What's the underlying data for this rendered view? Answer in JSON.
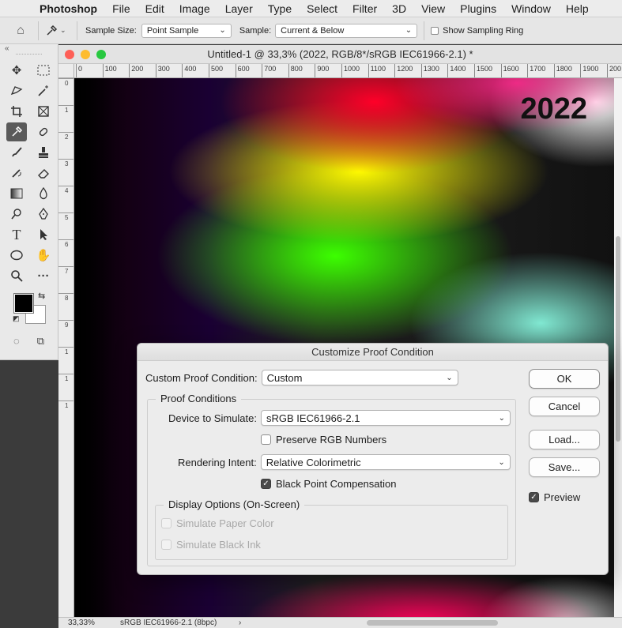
{
  "menubar": {
    "app": "Photoshop",
    "items": [
      "File",
      "Edit",
      "Image",
      "Layer",
      "Type",
      "Select",
      "Filter",
      "3D",
      "View",
      "Plugins",
      "Window",
      "Help"
    ]
  },
  "options_bar": {
    "sample_size_label": "Sample Size:",
    "sample_size_value": "Point Sample",
    "sample_label": "Sample:",
    "sample_value": "Current & Below",
    "show_ring_label": "Show Sampling Ring"
  },
  "document": {
    "title": "Untitled-1 @ 33,3% (2022, RGB/8*/sRGB IEC61966-2.1) *",
    "ruler_ticks": [
      "0",
      "100",
      "200",
      "300",
      "400",
      "500",
      "600",
      "700",
      "800",
      "900",
      "1000",
      "1100",
      "1200",
      "1300",
      "1400",
      "1500",
      "1600",
      "1700",
      "1800",
      "1900",
      "200"
    ],
    "vruler_labels": [
      "0",
      "1",
      "2",
      "3",
      "4",
      "5",
      "6",
      "7",
      "8",
      "9",
      "1",
      "1",
      "1"
    ],
    "canvas_text": "2022",
    "status_zoom": "33,33%",
    "status_profile": "sRGB IEC61966-2.1 (8bpc)"
  },
  "dialog": {
    "title": "Customize Proof Condition",
    "custom_label": "Custom Proof Condition:",
    "custom_value": "Custom",
    "proof_group": "Proof Conditions",
    "device_label": "Device to Simulate:",
    "device_value": "sRGB IEC61966-2.1",
    "preserve_label": "Preserve RGB Numbers",
    "intent_label": "Rendering Intent:",
    "intent_value": "Relative Colorimetric",
    "bpc_label": "Black Point Compensation",
    "display_group": "Display Options (On-Screen)",
    "paper_label": "Simulate Paper Color",
    "ink_label": "Simulate Black Ink",
    "ok": "OK",
    "cancel": "Cancel",
    "load": "Load...",
    "save": "Save...",
    "preview": "Preview"
  },
  "states": {
    "preserve_rgb": false,
    "black_point_compensation": true,
    "preview": true,
    "show_sampling_ring": false
  },
  "colors": {
    "foreground": "#000000",
    "background": "#ffffff",
    "traffic_red": "#fe5f57",
    "traffic_yellow": "#febc2e",
    "traffic_green": "#28c840"
  }
}
